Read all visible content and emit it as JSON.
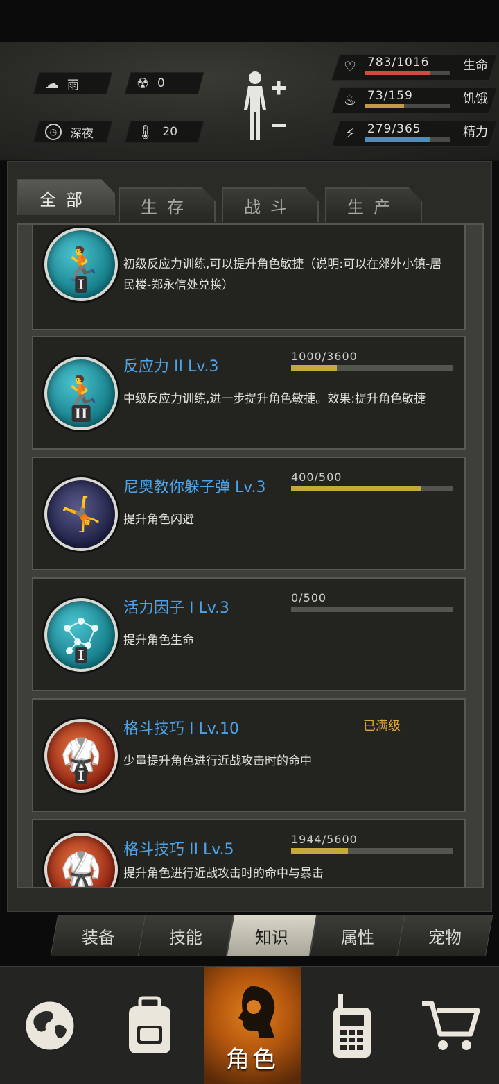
{
  "status": {
    "weather": {
      "icon": "rain-cloud-icon",
      "label": "雨"
    },
    "radiation": {
      "icon": "radiation-icon",
      "value": "0"
    },
    "time": {
      "icon": "clock-icon",
      "label": "深夜"
    },
    "temperature": {
      "icon": "thermometer-icon",
      "value": "20"
    },
    "stats": [
      {
        "key": "life",
        "icon": "heart-icon",
        "value": "783/1016",
        "label": "生命",
        "fraction": 0.77,
        "color": "#c95040"
      },
      {
        "key": "hunger",
        "icon": "stomach-icon",
        "value": "73/159",
        "label": "饥饿",
        "fraction": 0.46,
        "color": "#c49a4a"
      },
      {
        "key": "energy",
        "icon": "lightning-icon",
        "value": "279/365",
        "label": "精力",
        "fraction": 0.76,
        "color": "#4a8bc8"
      }
    ]
  },
  "tabs": [
    {
      "label": "全部",
      "active": true
    },
    {
      "label": "生存",
      "active": false
    },
    {
      "label": "战斗",
      "active": false
    },
    {
      "label": "生产",
      "active": false
    }
  ],
  "cards": [
    {
      "title": "",
      "desc": "初级反应力训练,可以提升角色敏捷（说明:可以在郊外小镇-居民楼-郑永信处兑换）",
      "medal": "reflex-training-icon",
      "rank": "I",
      "theme": "teal",
      "progress": null,
      "max_label": null
    },
    {
      "title": "反应力 II Lv.3",
      "desc": "中级反应力训练,进一步提升角色敏捷。效果:提升角色敏捷",
      "medal": "reflex-training-icon",
      "rank": "II",
      "theme": "teal",
      "progress": "1000/3600",
      "fraction": 0.28,
      "max_label": null
    },
    {
      "title": "尼奥教你躲子弹 Lv.3",
      "desc": "提升角色闪避",
      "medal": "dodge-bullet-icon",
      "rank": "",
      "theme": "navy",
      "progress": "400/500",
      "fraction": 0.8,
      "max_label": null
    },
    {
      "title": "活力因子 I Lv.3",
      "desc": "提升角色生命",
      "medal": "molecule-icon",
      "rank": "I",
      "theme": "teal",
      "progress": "0/500",
      "fraction": 0.0,
      "max_label": null
    },
    {
      "title": "格斗技巧 I Lv.10",
      "desc": "少量提升角色进行近战攻击时的命中",
      "medal": "fighter-stance-icon",
      "rank": "I",
      "theme": "red",
      "progress": null,
      "max_label": "已满级"
    },
    {
      "title": "格斗技巧 II Lv.5",
      "desc": "提升角色进行近战攻击时的命中与暴击",
      "medal": "fighter-stance-icon",
      "rank": "",
      "theme": "red",
      "progress": "1944/5600",
      "fraction": 0.35,
      "max_label": null
    }
  ],
  "subnav": [
    {
      "label": "装备",
      "active": false
    },
    {
      "label": "技能",
      "active": false
    },
    {
      "label": "知识",
      "active": true
    },
    {
      "label": "属性",
      "active": false
    },
    {
      "label": "宠物",
      "active": false
    }
  ],
  "bottomnav": [
    {
      "icon": "globe-icon",
      "label": ""
    },
    {
      "icon": "backpack-icon",
      "label": ""
    },
    {
      "icon": "character-head-icon",
      "label": "角色",
      "active": true
    },
    {
      "icon": "radio-icon",
      "label": ""
    },
    {
      "icon": "cart-icon",
      "label": ""
    }
  ]
}
